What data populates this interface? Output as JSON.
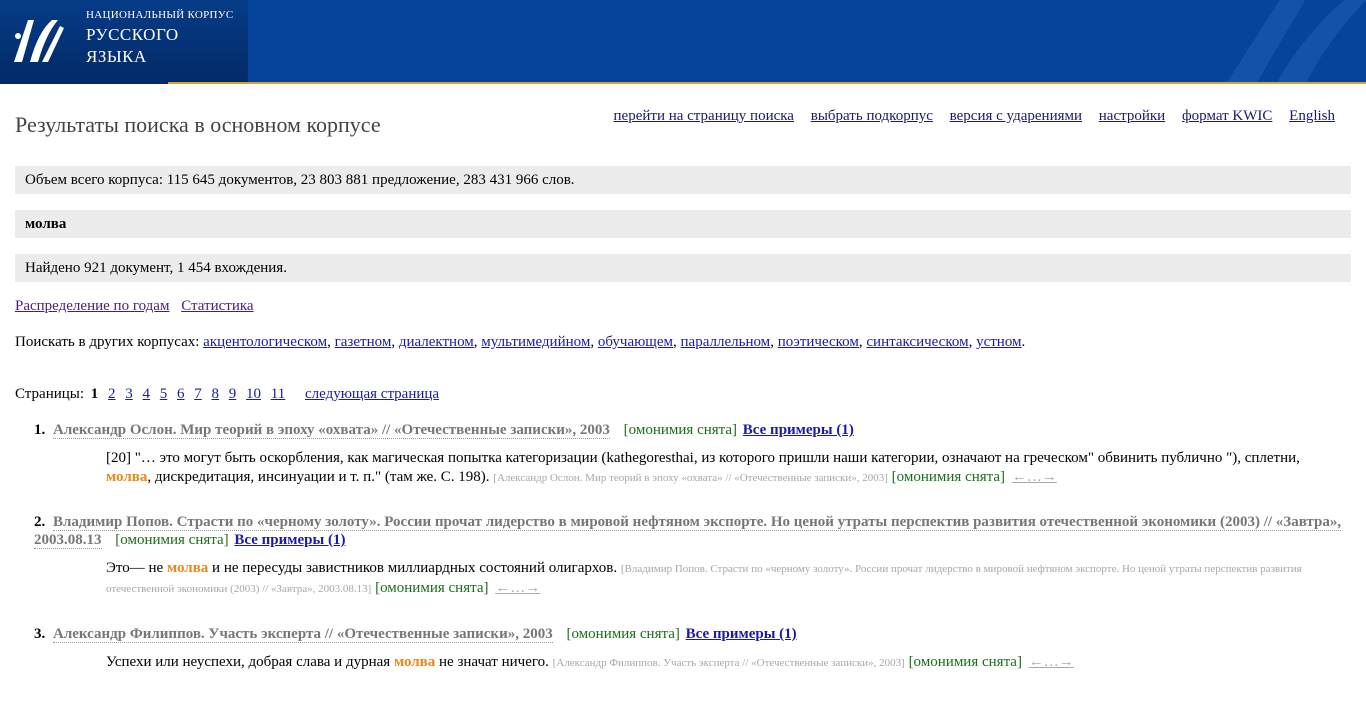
{
  "header": {
    "logo_line1": "НАЦИОНАЛЬНЫЙ КОРПУС",
    "logo_line2": "РУССКОГО",
    "logo_line3": "ЯЗЫКА"
  },
  "page_title": "Результаты поиска в основном корпусе",
  "nav": [
    "перейти на страницу поиска",
    "выбрать подкорпус",
    "версия с ударениями",
    "настройки",
    "формат KWIC",
    "English"
  ],
  "corpus_volume": "Объем всего корпуса: 115 645 документов, 23 803 881 предложение, 283 431 966 слов.",
  "query": "молва",
  "found": "Найдено 921 документ, 1 454 вхождения.",
  "distribution_link": "Распределение по годам",
  "statistics_link": "Статистика",
  "other_corpora": {
    "label": "Поискать в других корпусах:",
    "items": [
      "акцентологическом",
      "газетном",
      "диалектном",
      "мультимедийном",
      "обучающем",
      "параллельном",
      "поэтическом",
      "синтаксическом",
      "устном"
    ]
  },
  "pagination": {
    "label": "Страницы:",
    "current": "1",
    "pages": [
      "2",
      "3",
      "4",
      "5",
      "6",
      "7",
      "8",
      "9",
      "10",
      "11"
    ],
    "next": "следующая страница"
  },
  "results": [
    {
      "num": "1.",
      "doc": "Александр Ослон. Мир теорий в эпоху «охвата» // «Отечественные записки», 2003",
      "homonymy": "[омонимия снята]",
      "all_examples": "Все примеры (1)",
      "before": "[20] \"… это могут быть оскорбления, как магическая попытка категоризации (kathegoresthai, из которого пришли наши категории, означают на греческом\" обвинить публично \"), сплетни, ",
      "hit": "молва",
      "after": ", дискредитация, инсинуации и т. п.\" (там же. С. 198). ",
      "source": "[Александр Ослон. Мир теорий в эпоху «охвата» // «Отечественные записки», 2003]",
      "homonymy2": "[омонимия снята]",
      "arrows": "←…→"
    },
    {
      "num": "2.",
      "doc": "Владимир Попов. Страсти по «черному золоту». России прочат лидерство в мировой нефтяном экспорте. Но ценой утраты перспектив развития отечественной экономики (2003) // «Завтра», 2003.08.13",
      "homonymy": "[омонимия снята]",
      "all_examples": "Все примеры (1)",
      "before": "Это— не ",
      "hit": "молва",
      "after": " и не пересуды завистников миллиардных состояний олигархов. ",
      "source": "[Владимир Попов. Страсти по «черному золоту». России прочат лидерство в мировой нефтяном экспорте. Но ценой утраты перспектив развития отечественной экономики (2003) // «Завтра», 2003.08.13]",
      "homonymy2": "[омонимия снята]",
      "arrows": "←…→"
    },
    {
      "num": "3.",
      "doc": "Александр Филиппов. Участь эксперта // «Отечественные записки», 2003",
      "homonymy": "[омонимия снята]",
      "all_examples": "Все примеры (1)",
      "before": "Успехи или неуспехи, добрая слава и дурная ",
      "hit": "молва",
      "after": " не значат ничего. ",
      "source": "[Александр Филиппов. Участь эксперта // «Отечественные записки», 2003]",
      "homonymy2": "[омонимия снята]",
      "arrows": "←…→"
    }
  ],
  "colors": {
    "banner": "#05449a",
    "stripe": "#e0a020",
    "highlight": "#e88a1a",
    "homonymy": "#1a6e1a",
    "link": "#1a1aa6"
  }
}
